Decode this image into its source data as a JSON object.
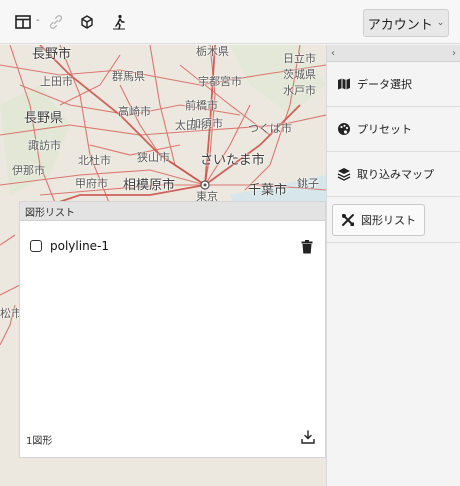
{
  "toolbar": {
    "icons": [
      "layout-columns-icon",
      "link-icon",
      "cube-icon",
      "pedestrian-icon"
    ],
    "separator": "-",
    "account_label": "アカウント",
    "account_caret": "⌄"
  },
  "map": {
    "labels": [
      "長野市",
      "栃木県",
      "日立市",
      "上田市",
      "群馬県",
      "宇都宮市",
      "茨城県",
      "長野県",
      "高崎市",
      "前橋市",
      "水戸市",
      "太田市",
      "加須市",
      "つくば市",
      "諏訪市",
      "伊那市",
      "北杜市",
      "狭山市",
      "さいたま市",
      "甲府市",
      "相模原市",
      "千葉市",
      "東京",
      "銚子",
      "松市"
    ],
    "colors": {
      "land": "#eae6dd",
      "road": "#d9534f",
      "water": "#cfe3ec"
    }
  },
  "side": {
    "collapse_left": "‹",
    "collapse_right": "›",
    "items": [
      {
        "label": "データ選択",
        "icon": "map-icon"
      },
      {
        "label": "プリセット",
        "icon": "palette-icon"
      },
      {
        "label": "取り込みマップ",
        "icon": "layers-icon"
      },
      {
        "label": "図形リスト",
        "icon": "tools-icon"
      }
    ]
  },
  "shape_panel": {
    "title": "図形リスト",
    "items": [
      {
        "label": "polyline-1",
        "checked": false
      }
    ],
    "count_text": "1図形"
  }
}
